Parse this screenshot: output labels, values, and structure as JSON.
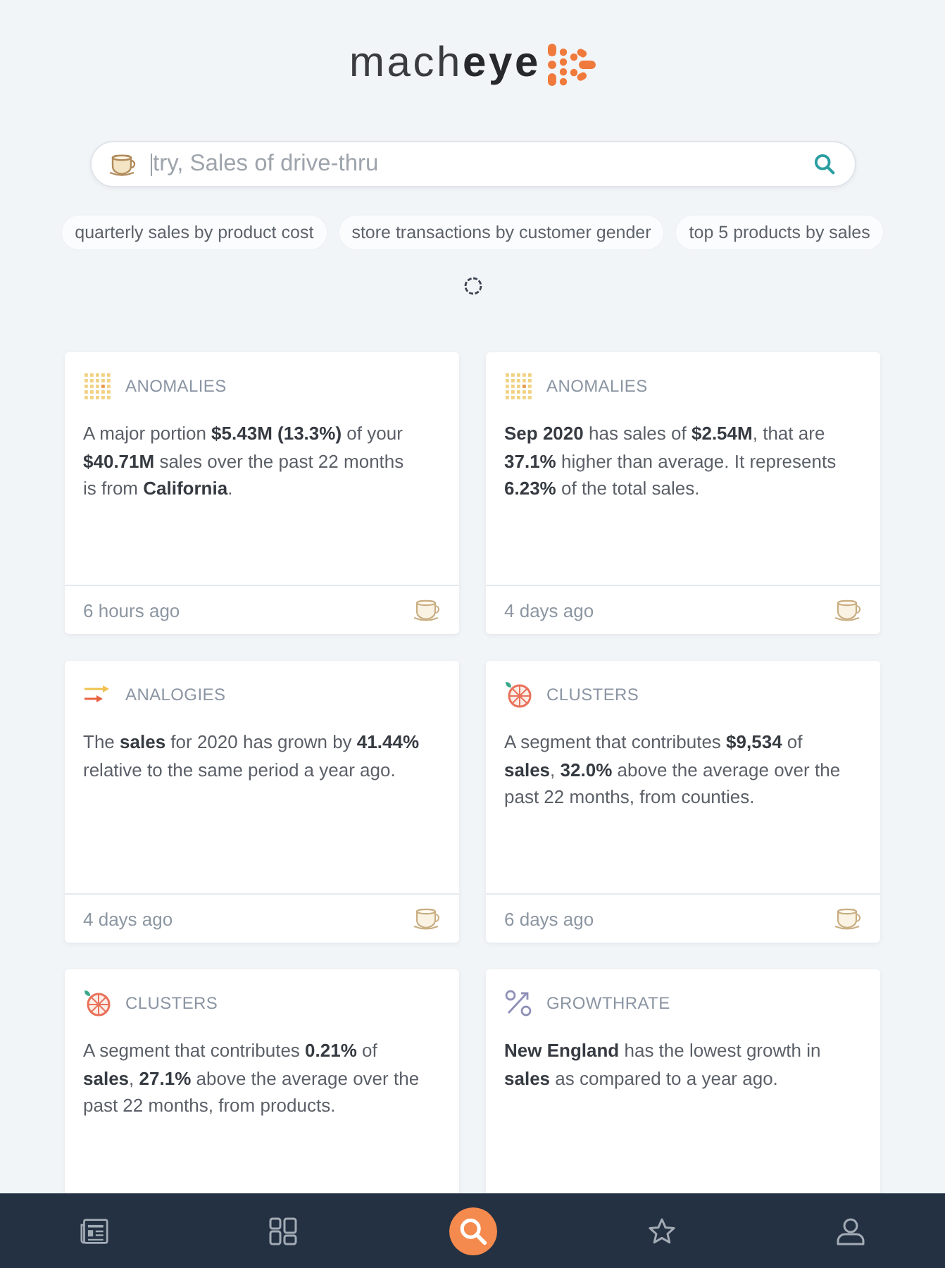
{
  "logo": {
    "text": "mach**eye**"
  },
  "search": {
    "placeholder": "try, Sales of drive-thru",
    "focused": true
  },
  "suggestions": [
    "quarterly sales by product cost",
    "store transactions by customer gender",
    "top 5 products by sales"
  ],
  "loading": true,
  "cards": [
    {
      "kind": "anomalies",
      "label": "ANOMALIES",
      "text": "A major portion **$5.43M (13.3%)** of your **$40.71M** sales over the past 22 months is from **California**.",
      "time": "6 hours ago"
    },
    {
      "kind": "anomalies",
      "label": "ANOMALIES",
      "text": "**Sep 2020** has sales of **$2.54M**, that are **37.1%** higher than average. It represents **6.23%** of the total sales.",
      "time": "4 days ago"
    },
    {
      "kind": "analogies",
      "label": "ANALOGIES",
      "text": "The **sales** for 2020 has grown by **41.44%** relative to the same period a year ago.",
      "time": "4 days ago"
    },
    {
      "kind": "clusters",
      "label": "CLUSTERS",
      "text": "A segment that contributes **$9,534** of **sales**, **32.0%** above the average over the past 22 months, from counties.",
      "time": "6 days ago"
    },
    {
      "kind": "clusters",
      "label": "CLUSTERS",
      "text": "A segment that contributes **0.21%** of **sales**, **27.1%** above the average over the past 22 months, from products."
    },
    {
      "kind": "growthrate",
      "label": "GROWTHRATE",
      "text": "**New England** has the lowest growth in **sales** as compared to a year ago."
    }
  ],
  "bottom_nav": [
    {
      "kind": "feed",
      "selected": false
    },
    {
      "kind": "dashboard",
      "selected": false
    },
    {
      "kind": "search",
      "selected": true
    },
    {
      "kind": "favorites",
      "selected": false
    },
    {
      "kind": "profile",
      "selected": false
    }
  ]
}
